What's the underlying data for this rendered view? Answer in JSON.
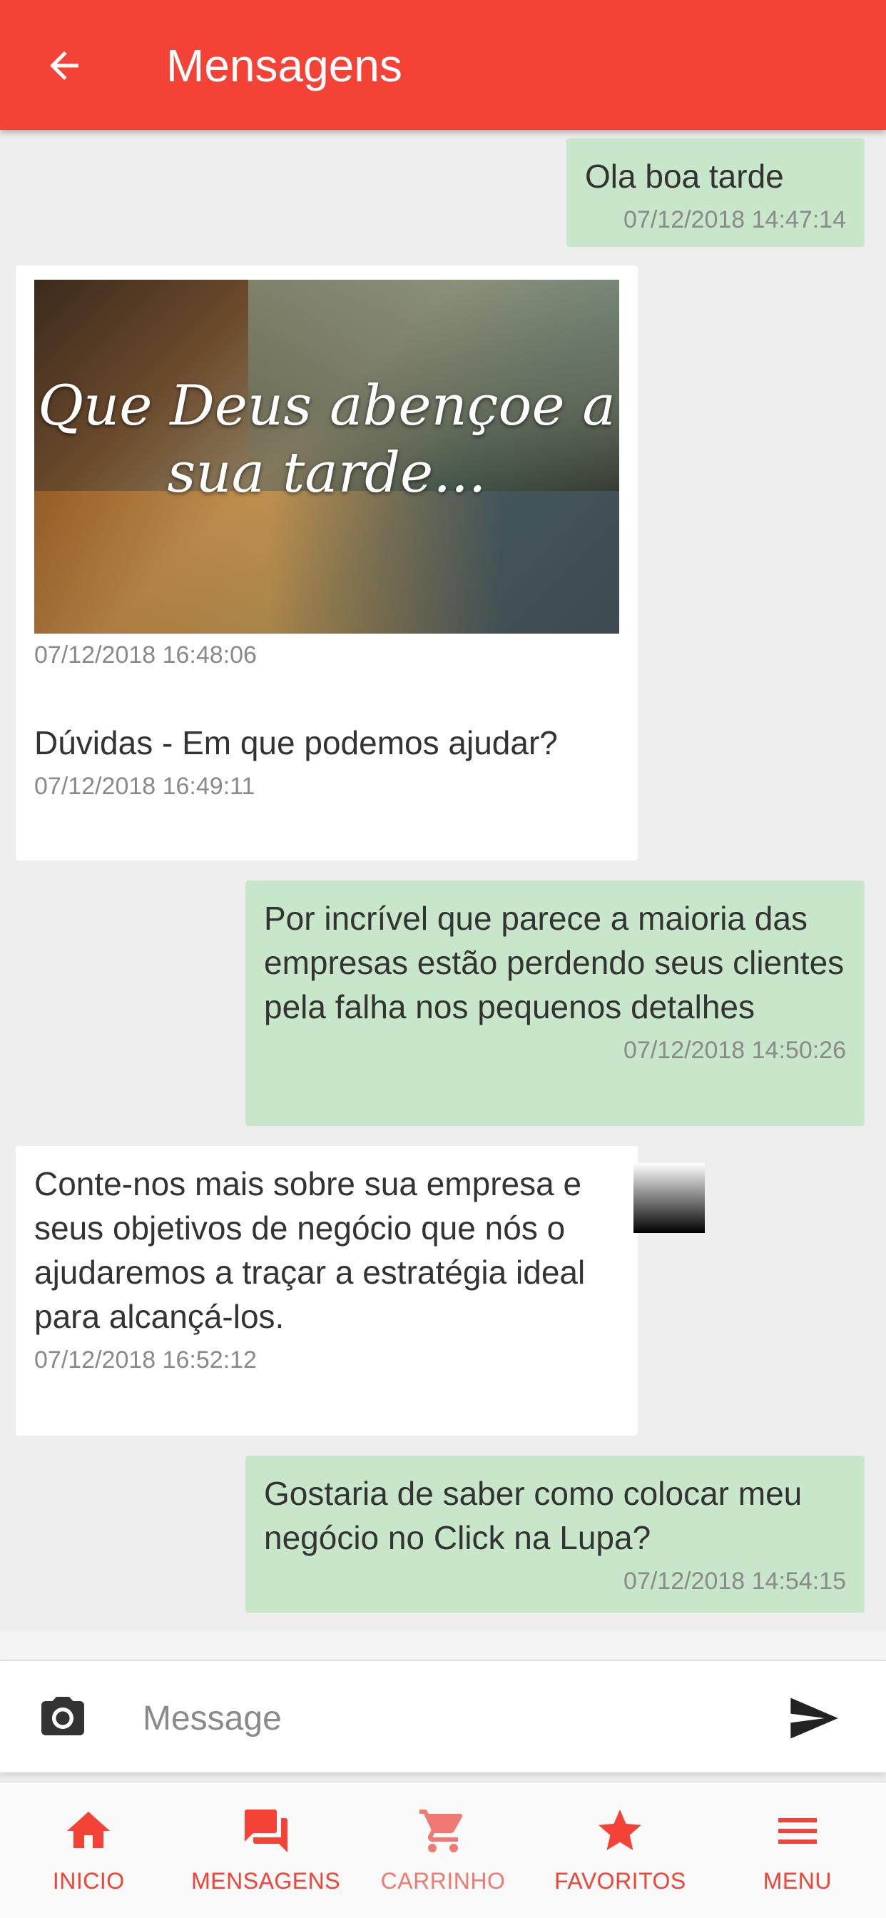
{
  "header": {
    "title": "Mensagens"
  },
  "messages": [
    {
      "direction": "out",
      "text": "Ola boa tarde",
      "time": "07/12/2018 14:47:14"
    },
    {
      "direction": "in",
      "type": "image",
      "image_caption": "Que Deus abençoe a sua tarde...",
      "time": "07/12/2018 16:48:06"
    },
    {
      "direction": "in",
      "text": "Dúvidas - Em que podemos ajudar?",
      "time": "07/12/2018 16:49:11"
    },
    {
      "direction": "out",
      "text": "Por incrível que parece a maioria das empresas estão perdendo seus clientes pela falha nos pequenos detalhes",
      "time": "07/12/2018 14:50:26"
    },
    {
      "direction": "in",
      "text": "Conte-nos mais sobre sua empresa e seus objetivos de negócio que nós o ajudaremos a traçar a estratégia ideal para alcançá-los.",
      "time": "07/12/2018 16:52:12"
    },
    {
      "direction": "out",
      "text": "Gostaria de saber como colocar meu negócio no Click na Lupa?",
      "time": "07/12/2018 14:54:15"
    }
  ],
  "composer": {
    "placeholder": "Message",
    "camera_icon": "camera-icon",
    "send_icon": "send-icon"
  },
  "nav": [
    {
      "label": "INICIO",
      "icon": "home-icon"
    },
    {
      "label": "MENSAGENS",
      "icon": "chat-icon"
    },
    {
      "label": "CARRINHO",
      "icon": "cart-icon"
    },
    {
      "label": "FAVORITOS",
      "icon": "star-icon"
    },
    {
      "label": "MENU",
      "icon": "menu-icon"
    }
  ],
  "colors": {
    "primary": "#f44336",
    "outgoing_bubble": "#c8e6c9",
    "incoming_bubble": "#ffffff",
    "background": "#eeeeee"
  }
}
